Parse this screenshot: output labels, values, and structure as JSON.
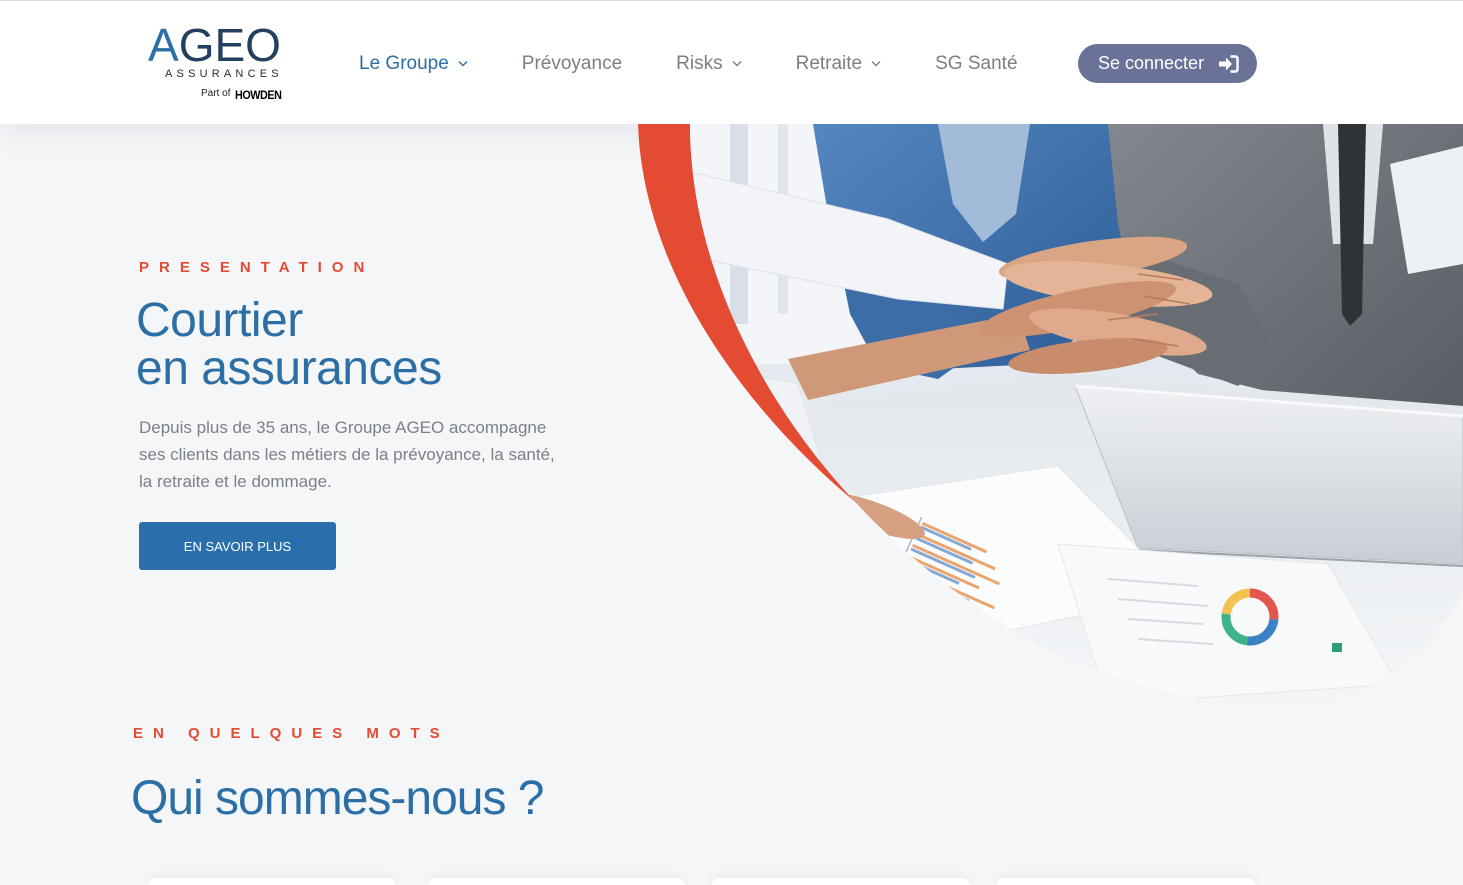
{
  "colors": {
    "accent_blue": "#2c6ea6",
    "accent_red": "#e34b33",
    "login_button": "#6b7298",
    "nav_text": "#7a7e85",
    "page_background": "#f5f6f8",
    "cta_button": "#2a6fab"
  },
  "header": {
    "logo": {
      "wordmark": "AGEO",
      "tagline": "ASSURANCES",
      "part_of": "Part of",
      "parent_brand": "HOWDEN"
    },
    "nav": [
      {
        "label": "Le Groupe",
        "dropdown": true,
        "active": true
      },
      {
        "label": "Prévoyance",
        "dropdown": false,
        "active": false
      },
      {
        "label": "Risks",
        "dropdown": true,
        "active": false
      },
      {
        "label": "Retraite",
        "dropdown": true,
        "active": false
      },
      {
        "label": "SG Santé",
        "dropdown": false,
        "active": false
      }
    ],
    "login": {
      "label": "Se connecter",
      "icon": "sign-in-icon"
    }
  },
  "hero": {
    "eyebrow": "PRESENTATION",
    "title_lines": [
      "Courtier",
      "en assurances"
    ],
    "description_lines": [
      "Depuis plus de 35 ans, le Groupe AGEO accompagne",
      "ses clients dans les métiers de la prévoyance, la santé,",
      "la retraite et le dommage."
    ],
    "cta_label": "EN SAVOIR PLUS"
  },
  "about": {
    "eyebrow": "EN QUELQUES MOTS",
    "title": "Qui sommes-nous ?"
  }
}
